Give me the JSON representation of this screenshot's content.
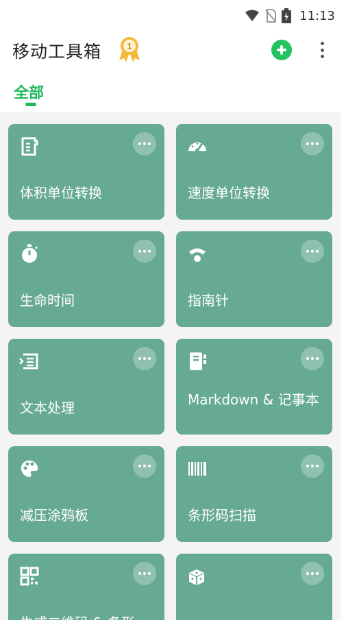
{
  "status_bar": {
    "time": "11:13"
  },
  "app_bar": {
    "title": "移动工具箱",
    "badge_number": "1"
  },
  "tabs": [
    {
      "label": "全部",
      "selected": true
    }
  ],
  "colors": {
    "accent": "#1fb85a",
    "card": "#66aa92",
    "badge": "#f5b93a"
  },
  "tools": [
    {
      "label": "体积单位转换",
      "icon": "measuring-cup-icon"
    },
    {
      "label": "速度单位转换",
      "icon": "speedometer-icon"
    },
    {
      "label": "生命时间",
      "icon": "stopwatch-icon"
    },
    {
      "label": "指南针",
      "icon": "wifi-signal-icon"
    },
    {
      "label": "文本处理",
      "icon": "text-edit-icon"
    },
    {
      "label": "Markdown & 记事本",
      "icon": "notebook-icon"
    },
    {
      "label": "减压涂鸦板",
      "icon": "palette-icon"
    },
    {
      "label": "条形码扫描",
      "icon": "barcode-icon"
    },
    {
      "label": "生成二维码 & 条形",
      "icon": "qr-code-icon"
    },
    {
      "label": "",
      "icon": "dice-icon"
    }
  ]
}
